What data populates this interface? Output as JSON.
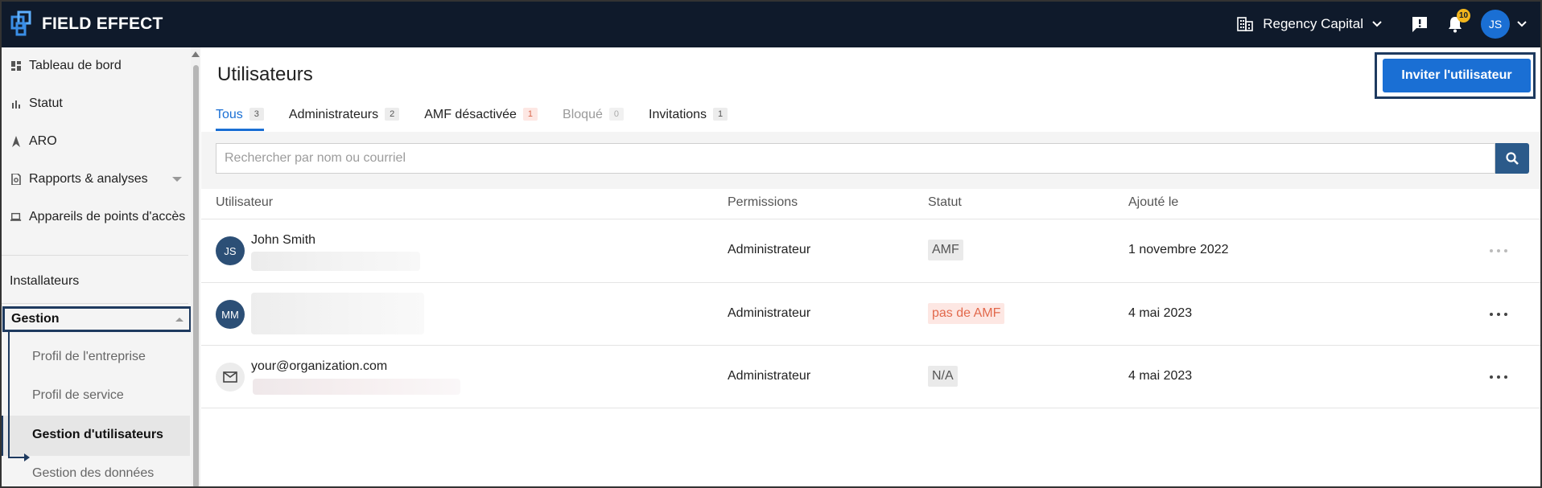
{
  "brand": {
    "name": "FIELD EFFECT"
  },
  "topbar": {
    "organization": "Regency Capital",
    "notifications_count": "10",
    "user_initials": "JS"
  },
  "sidebar": {
    "items": [
      {
        "label": "Tableau de bord",
        "icon": "dashboard-icon"
      },
      {
        "label": "Statut",
        "icon": "bar-chart-icon"
      },
      {
        "label": "ARO",
        "icon": "aro-icon"
      },
      {
        "label": "Rapports & analyses",
        "icon": "report-icon"
      },
      {
        "label": "Appareils de points d'accès",
        "icon": "laptop-icon"
      }
    ],
    "installers": "Installateurs",
    "group": "Gestion",
    "sub_items": [
      {
        "label": "Profil de l'entreprise"
      },
      {
        "label": "Profil de service"
      },
      {
        "label": "Gestion d'utilisateurs"
      },
      {
        "label": "Gestion des données"
      }
    ]
  },
  "page": {
    "title": "Utilisateurs",
    "invite_button": "Inviter l'utilisateur",
    "tabs": [
      {
        "label": "Tous",
        "count": "3"
      },
      {
        "label": "Administrateurs",
        "count": "2"
      },
      {
        "label": "AMF désactivée",
        "count": "1"
      },
      {
        "label": "Bloqué",
        "count": "0"
      },
      {
        "label": "Invitations",
        "count": "1"
      }
    ],
    "search_placeholder": "Rechercher par nom ou courriel"
  },
  "table": {
    "headers": [
      "Utilisateur",
      "Permissions",
      "Statut",
      "Ajouté le"
    ],
    "rows": [
      {
        "initials": "JS",
        "name": "John Smith",
        "permission": "Administrateur",
        "status": "AMF",
        "added": "1 novembre 2022"
      },
      {
        "initials": "MM",
        "name": "",
        "permission": "Administrateur",
        "status": "pas de AMF",
        "added": "4 mai 2023"
      },
      {
        "initials": "",
        "name": "your@organization.com",
        "permission": "Administrateur",
        "status": "N/A",
        "added": "4 mai 2023"
      }
    ]
  },
  "colors": {
    "topbar": "#0f1a2b",
    "primary": "#1a6fd4",
    "highlight_outline": "#1e3a5f",
    "warning_text": "#e2694c"
  }
}
